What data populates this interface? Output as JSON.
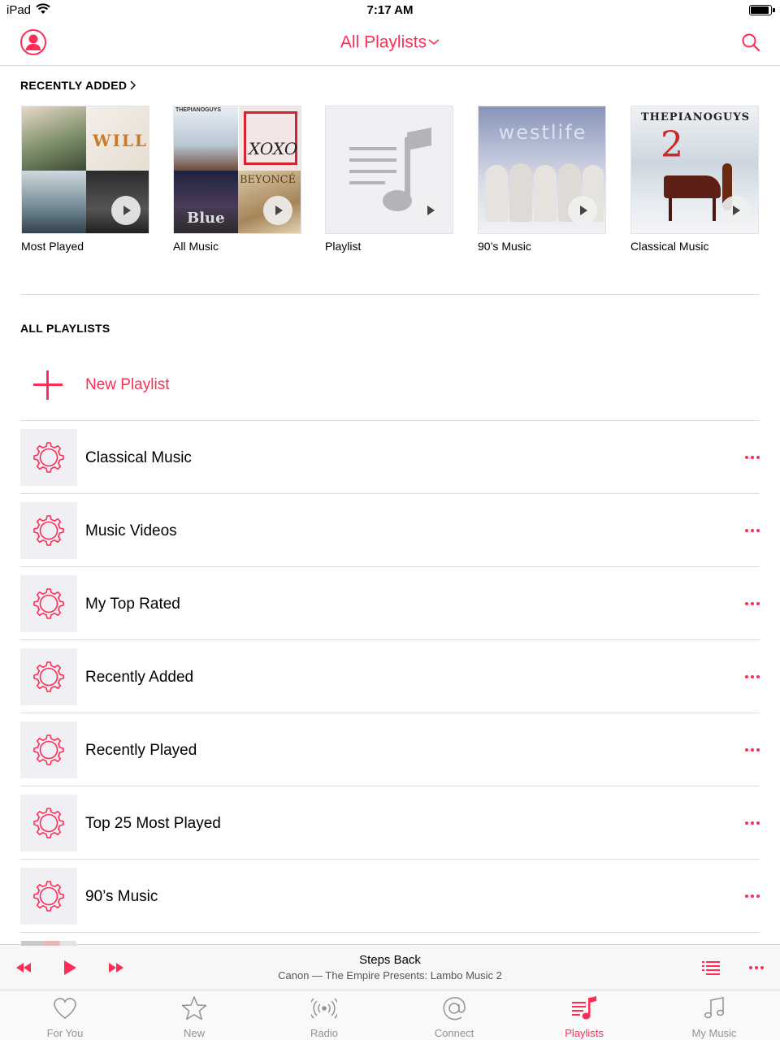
{
  "status_bar": {
    "device": "iPad",
    "time": "7:17 AM"
  },
  "nav": {
    "title": "All Playlists"
  },
  "recently_added": {
    "header": "RECENTLY ADDED",
    "items": [
      {
        "label": "Most Played"
      },
      {
        "label": "All Music"
      },
      {
        "label": "Playlist"
      },
      {
        "label": "90’s Music"
      },
      {
        "label": "Classical Music"
      }
    ],
    "art_text": {
      "westlife": "westlife",
      "piano_guys": "THEPIANOGUYS",
      "piano_guys_small": "THEPIANOGUYS",
      "will": "WILL",
      "exo": "XOXO",
      "beyonce": "BEYONCÉ",
      "blue": "Blue"
    }
  },
  "all_playlists": {
    "header": "ALL PLAYLISTS",
    "new_label": "New Playlist",
    "items": [
      {
        "title": "Classical Music"
      },
      {
        "title": "Music Videos"
      },
      {
        "title": "My Top Rated"
      },
      {
        "title": "Recently Added"
      },
      {
        "title": "Recently Played"
      },
      {
        "title": "Top 25 Most Played"
      },
      {
        "title": "90’s Music"
      }
    ]
  },
  "now_playing": {
    "title": "Steps Back",
    "subtitle": "Canon — The Empire Presents: Lambo Music 2"
  },
  "tab_bar": {
    "tabs": [
      {
        "label": "For You",
        "icon": "heart-icon"
      },
      {
        "label": "New",
        "icon": "star-icon"
      },
      {
        "label": "Radio",
        "icon": "radio-icon"
      },
      {
        "label": "Connect",
        "icon": "at-icon"
      },
      {
        "label": "Playlists",
        "icon": "playlists-icon",
        "active": true
      },
      {
        "label": "My Music",
        "icon": "music-note-icon"
      }
    ]
  },
  "colors": {
    "accent": "#ff2d55",
    "inactive": "#929292",
    "separator": "#dcdce0"
  }
}
